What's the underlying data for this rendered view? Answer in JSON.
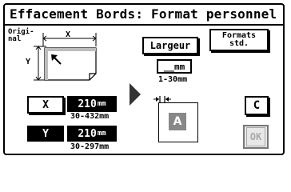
{
  "window": {
    "title": "Effacement Bords: Format personnel"
  },
  "diagram": {
    "label_line1": "Origi-",
    "label_line2": "nal",
    "x_label": "X",
    "y_label": "Y"
  },
  "x_field": {
    "button_label": "X",
    "value": "210",
    "unit": "mm",
    "range": "30-432mm"
  },
  "y_field": {
    "button_label": "Y",
    "value": "210",
    "unit": "mm",
    "range": "30-297mm"
  },
  "largeur": {
    "button_label": "Largeur",
    "value": "__",
    "unit": "mm",
    "range": "1-30mm"
  },
  "formats": {
    "line1": "Formats",
    "line2": "std."
  },
  "preview": {
    "letter": "A"
  },
  "actions": {
    "clear_label": "C",
    "ok_label": "OK"
  }
}
